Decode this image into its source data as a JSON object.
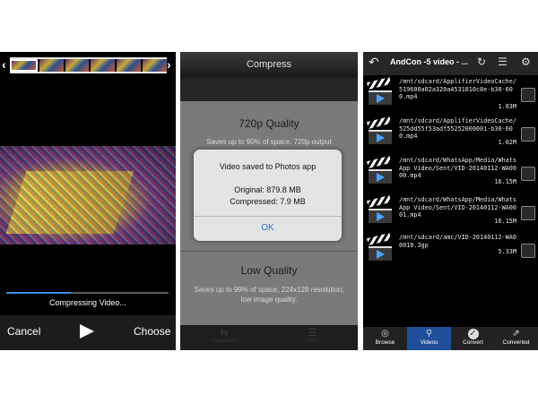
{
  "panel1": {
    "status_text": "Compressing Video...",
    "progress_fraction": 0.4,
    "cancel_label": "Cancel",
    "choose_label": "Choose",
    "bracket_left": "‹",
    "bracket_right": "›"
  },
  "panel2": {
    "nav_title": "Compress",
    "option_720_title": "720p Quality",
    "option_720_desc": "Saves up to 90% of space. 720p output",
    "option_low_title": "Low Quality",
    "option_low_desc": "Saves up to 99% of space, 224x128 resolution, low image quality.",
    "alert_title": "Video saved to Photos app",
    "alert_original": "Original: 879.8 MB",
    "alert_compressed": "Compressed: 7.9 MB",
    "alert_ok": "OK",
    "tab_compress": "Compress",
    "tab_info": "Info"
  },
  "panel3": {
    "title": "AndCon -5  video - ...",
    "files": [
      {
        "path": "/mnt/sdcard/ApplifierVideoCache/519600a02a320a4531010c8e-b30-600.mp4",
        "size": "1.03M"
      },
      {
        "path": "/mnt/sdcard/ApplifierVideoCache/525dd55f53adf55252000001-b30-600.mp4",
        "size": "1.02M"
      },
      {
        "path": "/mnt/sdcard/WhatsApp/Media/WhatsApp Video/Sent/VID-20140112-WA0000.mp4",
        "size": "16.15M"
      },
      {
        "path": "/mnt/sdcard/WhatsApp/Media/WhatsApp Video/Sent/VID-20140112-WA0001.mp4",
        "size": "16.15M"
      },
      {
        "path": "/mnt/sdcard/amc/VID-20140112-WA00010.3gp",
        "size": "5.33M"
      }
    ],
    "tabs": {
      "browse": "Browse",
      "videos": "Videos",
      "convert": "Convert",
      "converted": "Converted"
    },
    "accent_color": "#1f4f9a"
  }
}
